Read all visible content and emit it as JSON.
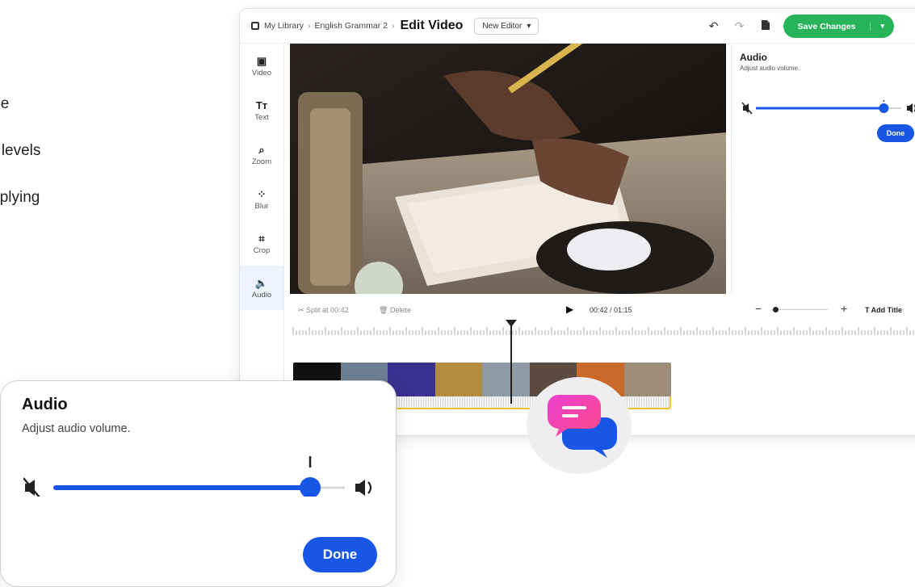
{
  "bullets": [
    "n timeline",
    "o adjust levels",
    "efore applying"
  ],
  "breadcrumb": {
    "library": "My Library",
    "course": "English Grammar 2",
    "title": "Edit Video"
  },
  "editor_select": {
    "value": "New Editor",
    "caret": "▾"
  },
  "toolbar": {
    "undo_icon": "undo-icon",
    "redo_icon": "redo-icon",
    "file_icon": "document-icon",
    "save_label": "Save Changes",
    "save_caret": "▾"
  },
  "sidebar": {
    "items": [
      {
        "label": "Video",
        "icon": "video-icon",
        "glyph": "▣"
      },
      {
        "label": "Text",
        "icon": "text-icon",
        "glyph": "Tт"
      },
      {
        "label": "Zoom",
        "icon": "zoom-icon",
        "glyph": "⌕"
      },
      {
        "label": "Blur",
        "icon": "blur-icon",
        "glyph": "⁘"
      },
      {
        "label": "Crop",
        "icon": "crop-icon",
        "glyph": "⌗"
      },
      {
        "label": "Audio",
        "icon": "audio-icon",
        "glyph": "🔈"
      }
    ]
  },
  "audio_panel": {
    "title": "Audio",
    "subtitle": "Adjust audio volume.",
    "volume": 0.88,
    "done_label": "Done"
  },
  "timeline": {
    "split_label": "Split at 00:42",
    "delete_label": "Delete",
    "time": "00:42 / 01:15",
    "zoom_minus": "−",
    "zoom_plus": "+",
    "add_title": "Add Title",
    "playhead_fraction": 0.555
  },
  "audio_card": {
    "title": "Audio",
    "subtitle": "Adjust audio volume.",
    "volume": 0.88,
    "done_label": "Done"
  },
  "colors": {
    "accent": "#1857e6",
    "save": "#27b35a",
    "track_border": "#f2c22e"
  }
}
